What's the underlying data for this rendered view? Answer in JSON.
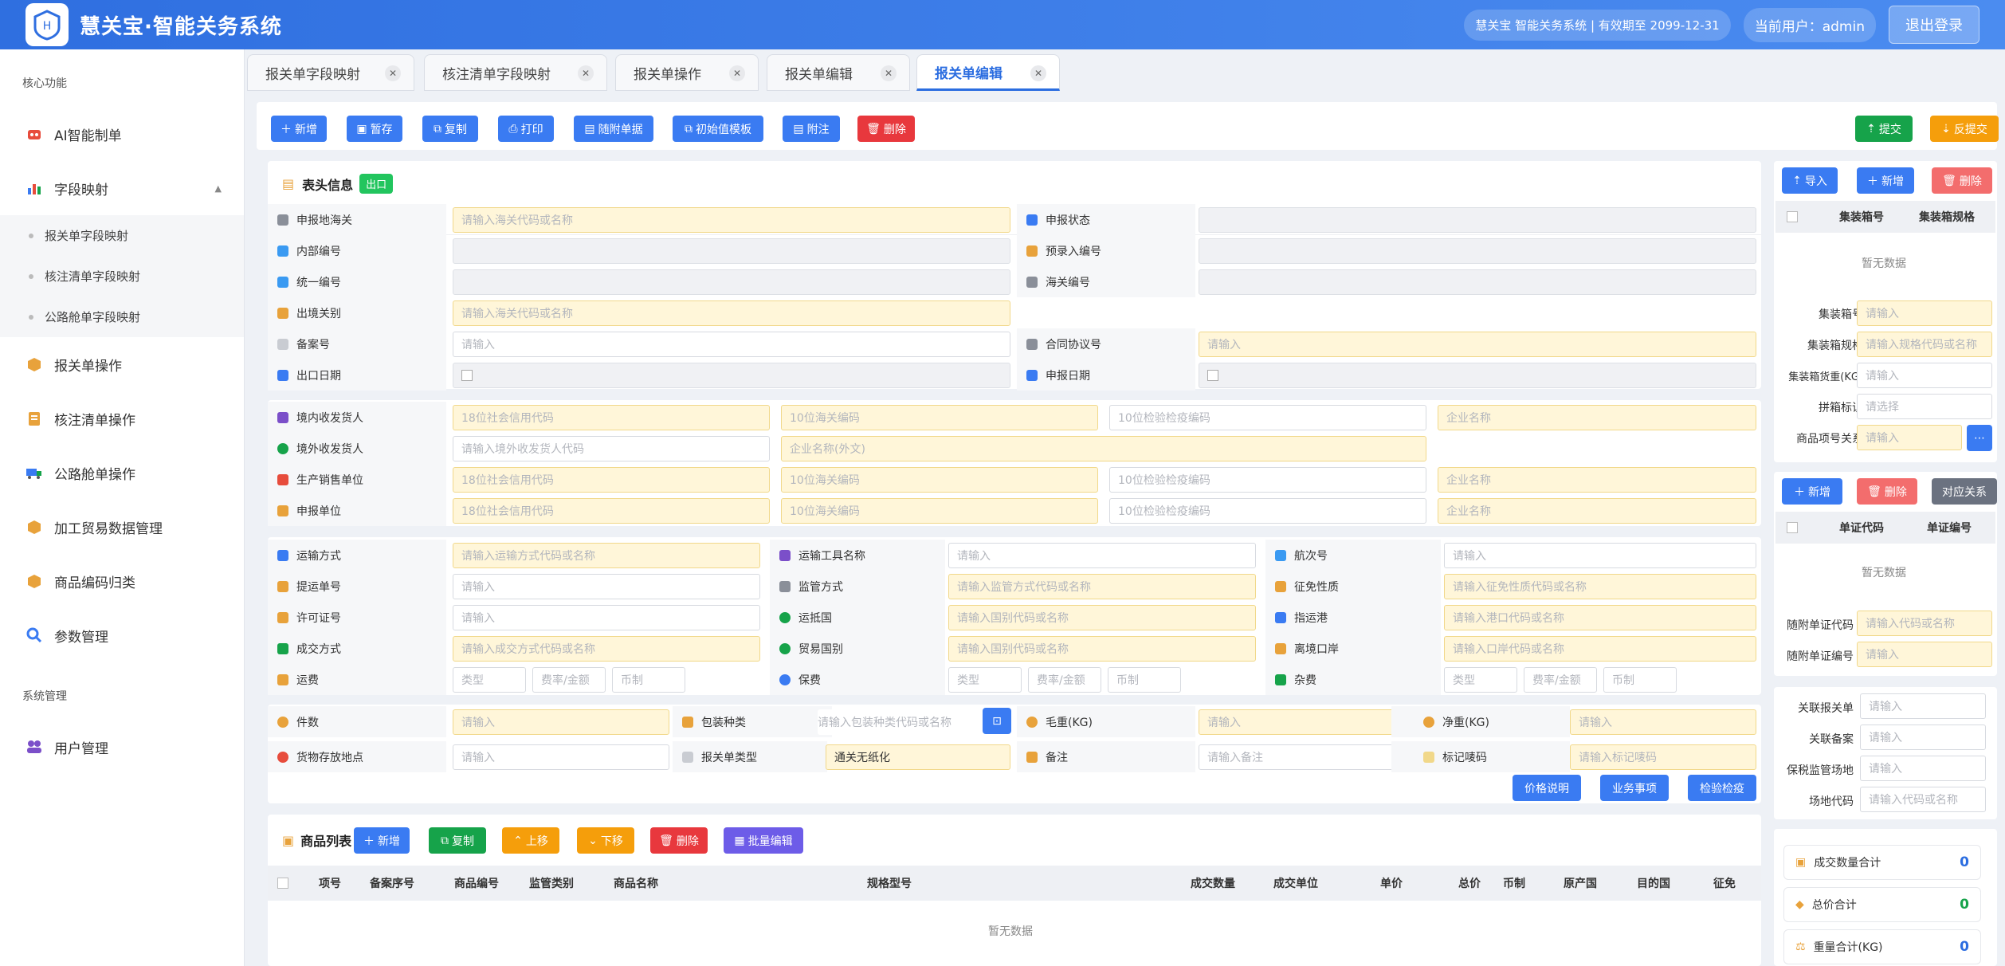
{
  "app": {
    "title": "慧关宝·智能关务系统",
    "license": "慧关宝 智能关务系统 | 有效期至 2099-12-31",
    "user": "当前用户：admin",
    "logout": "退出登录"
  },
  "sidebar": {
    "group1": "核心功能",
    "ai": "AI智能制单",
    "field_map": "字段映射",
    "sub1": "报关单字段映射",
    "sub2": "核注清单字段映射",
    "sub3": "公路舱单字段映射",
    "op1": "报关单操作",
    "op2": "核注清单操作",
    "op3": "公路舱单操作",
    "op4": "加工贸易数据管理",
    "op5": "商品编码归类",
    "op6": "参数管理",
    "group2": "系统管理",
    "users": "用户管理"
  },
  "tabs": [
    "报关单字段映射",
    "核注清单字段映射",
    "报关单操作",
    "报关单编辑",
    "报关单编辑"
  ],
  "toolbar": {
    "add": "新增",
    "save": "暂存",
    "copy": "复制",
    "print": "打印",
    "attach": "随附单据",
    "template": "初始值模板",
    "note": "附注",
    "delete": "删除",
    "submit": "提交",
    "unsubmit": "反提交"
  },
  "header": {
    "title": "表头信息",
    "badge": "出口",
    "l1": "申报地海关",
    "p1": "请输入海关代码或名称",
    "l2": "申报状态",
    "l3": "内部编号",
    "l4": "预录入编号",
    "l5": "统一编号",
    "l6": "海关编号",
    "l7": "出境关别",
    "p7": "请输入海关代码或名称",
    "l8": "备案号",
    "p8": "请输入",
    "l9": "合同协议号",
    "p9": "请输入",
    "l10": "出口日期",
    "l11": "申报日期"
  },
  "party": {
    "l1": "境内收发货人",
    "l2": "境外收发货人",
    "l3": "生产销售单位",
    "l4": "申报单位",
    "credit": "18位社会信用代码",
    "cust": "10位海关编码",
    "insp": "10位检验检疫编码",
    "name": "企业名称",
    "foreign_code": "请输入境外收发货人代码",
    "foreign_name": "企业名称(外文)"
  },
  "transport": {
    "l1": "运输方式",
    "p1": "请输入运输方式代码或名称",
    "l2": "运输工具名称",
    "p2": "请输入",
    "l3": "航次号",
    "p3": "请输入",
    "l4": "提运单号",
    "p4": "请输入",
    "l5": "监管方式",
    "p5": "请输入监管方式代码或名称",
    "l6": "征免性质",
    "p6": "请输入征免性质代码或名称",
    "l7": "许可证号",
    "p7": "请输入",
    "l8": "运抵国",
    "p8": "请输入国别代码或名称",
    "l9": "指运港",
    "p9": "请输入港口代码或名称",
    "l10": "成交方式",
    "p10": "请输入成交方式代码或名称",
    "l11": "贸易国别",
    "p11": "请输入国别代码或名称",
    "l12": "离境口岸",
    "p12": "请输入口岸代码或名称",
    "l13": "运费",
    "l14": "保费",
    "l15": "杂费",
    "type": "类型",
    "rate": "费率/金额",
    "cur": "币制"
  },
  "goods": {
    "l1": "件数",
    "p1": "请输入",
    "l2": "包装种类",
    "p2": "请输入包装种类代码或名称",
    "l3": "毛重(KG)",
    "p3": "请输入",
    "l4": "净重(KG)",
    "p4": "请输入",
    "l5": "货物存放地点",
    "p5": "请输入",
    "l6": "报关单类型",
    "v6": "通关无纸化",
    "l7": "备注",
    "p7": "请输入备注",
    "l8": "标记唛码",
    "p8": "请输入标记唛码",
    "btn1": "价格说明",
    "btn2": "业务事项",
    "btn3": "检验检疫"
  },
  "list": {
    "title": "商品列表",
    "add": "新增",
    "copy": "复制",
    "up": "上移",
    "down": "下移",
    "del": "删除",
    "batch": "批量编辑",
    "cols": [
      "项号",
      "备案序号",
      "商品编号",
      "监管类别",
      "商品名称",
      "规格型号",
      "成交数量",
      "成交单位",
      "单价",
      "总价",
      "币制",
      "原产国",
      "目的国",
      "征免"
    ],
    "empty": "暂无数据"
  },
  "right": {
    "import": "导入",
    "add": "新增",
    "del": "删除",
    "c1": "集装箱号",
    "c2": "集装箱规格",
    "empty": "暂无数据",
    "f1": "集装箱号",
    "fp1": "请输入",
    "f2": "集装箱规格",
    "fp2": "请输入规格代码或名称",
    "f3": "集装箱货重(KG)",
    "fp3": "请输入",
    "f4": "拼箱标识",
    "fp4": "请选择",
    "f5": "商品项号关系",
    "fp5": "请输入",
    "add2": "新增",
    "del2": "删除",
    "rel": "对应关系",
    "d1": "单证代码",
    "d2": "单证编号",
    "g1": "随附单证代码",
    "gp1": "请输入代码或名称",
    "g2": "随附单证编号",
    "gp2": "请输入",
    "h1": "关联报关单",
    "hp1": "请输入",
    "h2": "关联备案",
    "hp2": "请输入",
    "h3": "保税监管场地",
    "hp3": "请输入",
    "h4": "场地代码",
    "hp4": "请输入代码或名称",
    "s1": "成交数量合计",
    "v1": "0",
    "s2": "总价合计",
    "v2": "0",
    "s3": "重量合计(KG)",
    "v3": "0"
  }
}
